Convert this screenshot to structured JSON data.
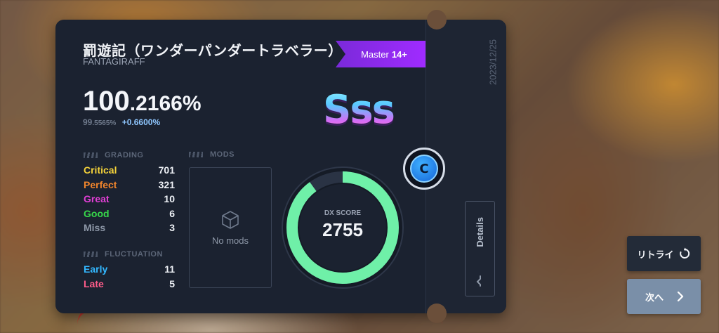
{
  "song": {
    "title": "罰遊記（ワンダーパンダートラベラー）",
    "artist": "FANTAGIRAFF",
    "difficulty": "Master",
    "level": "14+",
    "date": "2023/12/25"
  },
  "score": {
    "main_int": "100",
    "main_dec": ".2166%",
    "prev_int": "99",
    "prev_dec": ".5565%",
    "diff": "+0.6600%",
    "rank": "Sss"
  },
  "grading": {
    "header": "GRADING",
    "rows": [
      {
        "label": "Critical",
        "value": "701",
        "color": "#f5d33a"
      },
      {
        "label": "Perfect",
        "value": "321",
        "color": "#f2862c"
      },
      {
        "label": "Great",
        "value": "10",
        "color": "#e23fd6"
      },
      {
        "label": "Good",
        "value": "6",
        "color": "#37d94a"
      },
      {
        "label": "Miss",
        "value": "3",
        "color": "#8e98a8"
      }
    ]
  },
  "fluctuation": {
    "header": "FLUCTUATION",
    "rows": [
      {
        "label": "Early",
        "value": "11",
        "color": "#33b8ff"
      },
      {
        "label": "Late",
        "value": "5",
        "color": "#ff5c8a"
      }
    ]
  },
  "mods": {
    "header": "MODS",
    "empty_text": "No mods"
  },
  "dx": {
    "label": "DX SCORE",
    "value": "2755",
    "progress": 0.9,
    "ring_color": "#6ff0a8",
    "track_color": "#2a3344"
  },
  "clear_badge": "C",
  "buttons": {
    "details": "Details",
    "retry": "リトライ",
    "next": "次へ"
  },
  "icons": [
    "cube-icon",
    "retry-icon",
    "chevron-right-icon",
    "wave-icon"
  ]
}
